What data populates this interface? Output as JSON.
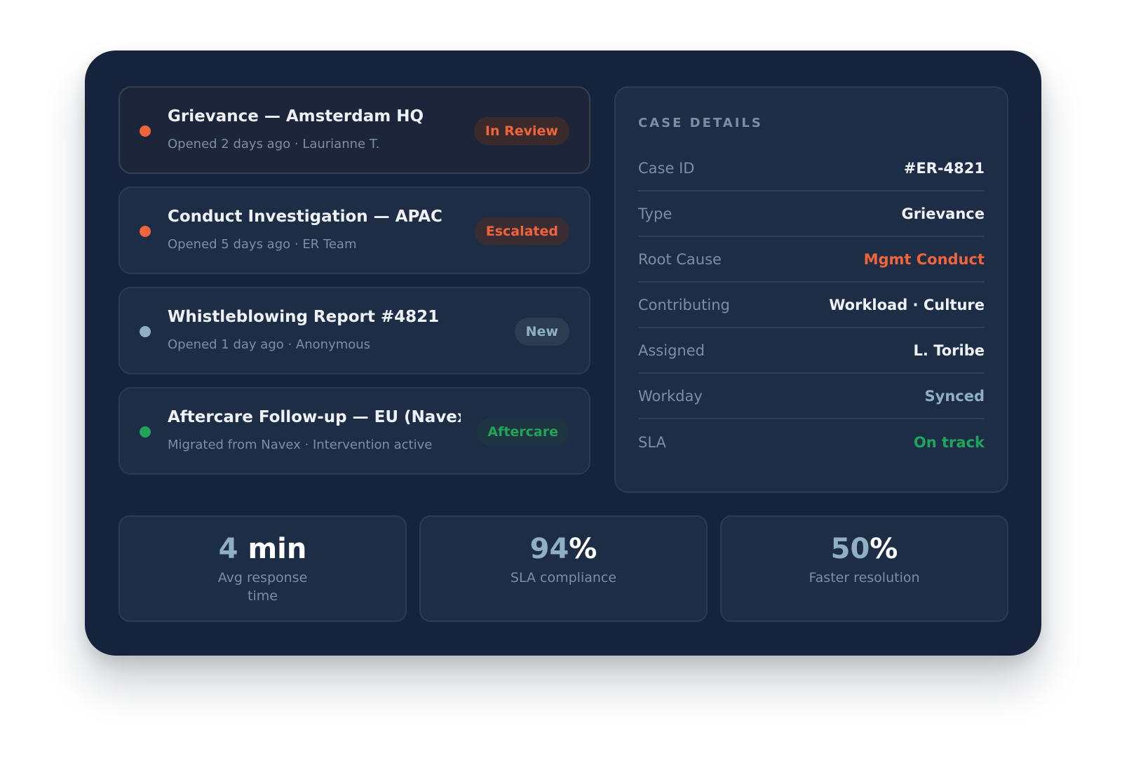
{
  "cases": [
    {
      "title": "Grievance — Amsterdam HQ",
      "meta": "Opened 2 days ago · Laurianne T.",
      "badge": "In Review",
      "dot_color": "#f0643c",
      "badge_color": "#f0643c",
      "badge_bg": "#3a2a2c",
      "selected": true
    },
    {
      "title": "Conduct Investigation — APAC",
      "meta": "Opened 5 days ago · ER Team",
      "badge": "Escalated",
      "dot_color": "#f0643c",
      "badge_color": "#f0643c",
      "badge_bg": "#3a2c33",
      "selected": false
    },
    {
      "title": "Whistleblowing Report #4821",
      "meta": "Opened 1 day ago · Anonymous",
      "badge": "New",
      "dot_color": "#8fb0c2",
      "badge_color": "#8fb0c2",
      "badge_bg": "#2c3d52",
      "selected": false
    },
    {
      "title": "Aftercare Follow-up — EU (Navex Legacy)",
      "meta": "Migrated from Navex · Intervention active",
      "badge": "Aftercare",
      "dot_color": "#22a35a",
      "badge_color": "#22a35a",
      "badge_bg": "#1e3441",
      "selected": false
    }
  ],
  "details": {
    "heading": "CASE DETAILS",
    "rows": [
      {
        "key": "Case ID",
        "value": "#ER-4821",
        "color": "#eef2f7"
      },
      {
        "key": "Type",
        "value": "Grievance",
        "color": "#eef2f7"
      },
      {
        "key": "Root Cause",
        "value": "Mgmt Conduct",
        "color": "#f0643c"
      },
      {
        "key": "Contributing",
        "value": "Workload · Culture",
        "color": "#eef2f7"
      },
      {
        "key": "Assigned",
        "value": "L. Toribe",
        "color": "#eef2f7"
      },
      {
        "key": "Workday",
        "value": "Synced",
        "color": "#8fb0c2"
      },
      {
        "key": "SLA",
        "value": "On track",
        "color": "#22a35a"
      }
    ]
  },
  "stats": [
    {
      "number": "4",
      "unit": " min",
      "label": "Avg response time"
    },
    {
      "number": "94",
      "unit": "%",
      "label": "SLA compliance"
    },
    {
      "number": "50",
      "unit": "%",
      "label": "Faster resolution"
    }
  ]
}
